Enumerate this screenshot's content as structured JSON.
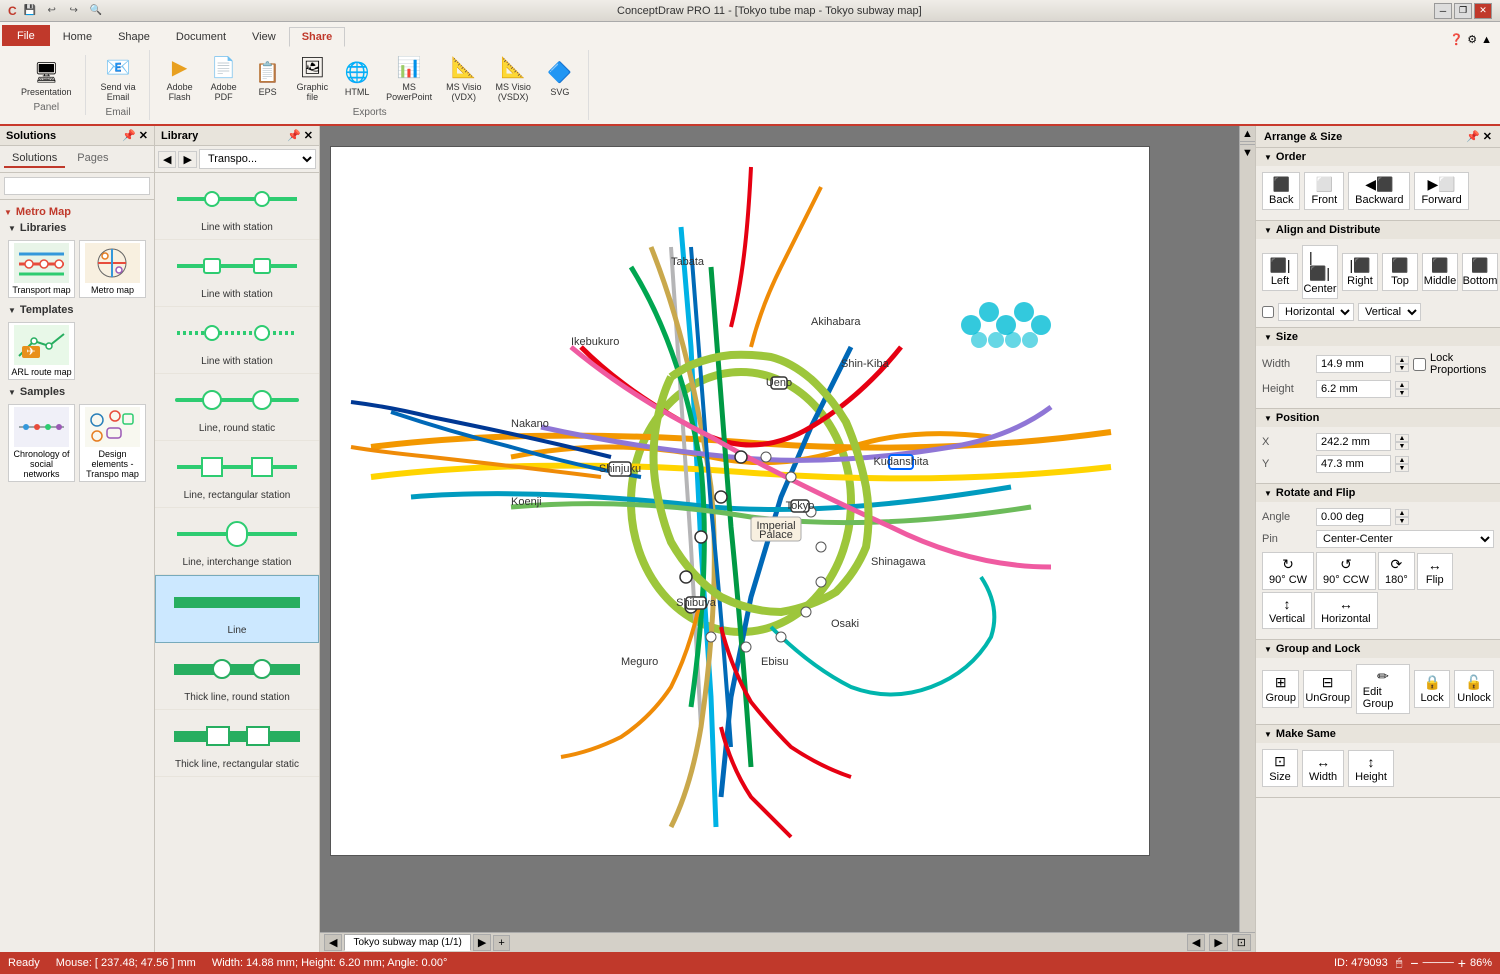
{
  "titlebar": {
    "title": "ConceptDraw PRO 11 - [Tokyo tube map - Tokyo subway map]",
    "controls": [
      "minimize",
      "restore",
      "close"
    ]
  },
  "ribbon": {
    "tabs": [
      "File",
      "Home",
      "Shape",
      "Document",
      "View",
      "Share"
    ],
    "active_tab": "Share",
    "file_tab": "File",
    "share_group": {
      "items": [
        {
          "label": "Presentation",
          "icon": "🖥",
          "group": "Panel"
        },
        {
          "label": "Send via Email",
          "icon": "📧",
          "group": "Email"
        },
        {
          "label": "Adobe Flash",
          "icon": "▶",
          "group": "Exports"
        },
        {
          "label": "Adobe PDF",
          "icon": "📄",
          "group": "Exports"
        },
        {
          "label": "EPS",
          "icon": "📋",
          "group": "Exports"
        },
        {
          "label": "Graphic file",
          "icon": "🖼",
          "group": "Exports"
        },
        {
          "label": "HTML",
          "icon": "🌐",
          "group": "Exports"
        },
        {
          "label": "MS PowerPoint",
          "icon": "📊",
          "group": "Exports"
        },
        {
          "label": "MS Visio (VDX)",
          "icon": "📐",
          "group": "Exports"
        },
        {
          "label": "MS Visio (VSDX)",
          "icon": "📐",
          "group": "Exports"
        },
        {
          "label": "SVG",
          "icon": "🔷",
          "group": "Exports"
        }
      ]
    }
  },
  "solutions": {
    "panel_title": "Solutions",
    "tabs": [
      "Solutions",
      "Pages"
    ],
    "search_placeholder": "",
    "sections": [
      {
        "name": "Metro Map",
        "subsections": [
          {
            "name": "Libraries",
            "items": [
              {
                "label": "Transport map",
                "type": "thumbnail"
              },
              {
                "label": "Metro map",
                "type": "thumbnail"
              },
              {
                "label": "ARL route map",
                "type": "thumbnail"
              },
              {
                "label": "Chronology of social networks",
                "type": "thumbnail"
              },
              {
                "label": "Design elements - Transport map",
                "type": "thumbnail"
              }
            ]
          },
          {
            "name": "Templates",
            "items": []
          },
          {
            "name": "Samples",
            "items": []
          }
        ]
      }
    ]
  },
  "library": {
    "panel_title": "Library",
    "nav_dropdown": "Transpo...",
    "items": [
      {
        "label": "Line with station",
        "type": "line_station"
      },
      {
        "label": "Line with station",
        "type": "line_station_2"
      },
      {
        "label": "Line with station",
        "type": "line_station_3"
      },
      {
        "label": "Line, round static",
        "type": "line_round"
      },
      {
        "label": "Line, rectangular station",
        "type": "line_rect"
      },
      {
        "label": "Line, interchange station",
        "type": "line_interchange"
      },
      {
        "label": "Line",
        "type": "line_plain",
        "selected": true
      },
      {
        "label": "Thick line, round station",
        "type": "thick_round"
      },
      {
        "label": "Thick line, rectangular static",
        "type": "thick_rect"
      }
    ]
  },
  "canvas": {
    "page_tab": "Tokyo subway map (1/1)",
    "background": "white"
  },
  "arrange": {
    "panel_title": "Arrange & Size",
    "sections": {
      "order": {
        "title": "Order",
        "buttons": [
          "Back",
          "Front",
          "Backward",
          "Forward"
        ]
      },
      "align": {
        "title": "Align and Distribute",
        "buttons": [
          "Left",
          "Center",
          "Right",
          "Top",
          "Middle",
          "Bottom"
        ],
        "dropdowns": [
          "Horizontal",
          "Vertical"
        ]
      },
      "size": {
        "title": "Size",
        "width_label": "Width",
        "width_value": "14.9 mm",
        "height_label": "Height",
        "height_value": "6.2 mm",
        "lock_label": "Lock Proportions"
      },
      "position": {
        "title": "Position",
        "x_label": "X",
        "x_value": "242.2 mm",
        "y_label": "Y",
        "y_value": "47.3 mm"
      },
      "rotate": {
        "title": "Rotate and Flip",
        "angle_label": "Angle",
        "angle_value": "0.00 deg",
        "pin_label": "Pin",
        "pin_value": "Center-Center",
        "buttons": [
          "90° CW",
          "90° CCW",
          "180°",
          "Flip",
          "Vertical",
          "Horizontal"
        ]
      },
      "group_lock": {
        "title": "Group and Lock",
        "buttons": [
          "Group",
          "UnGroup",
          "Edit Group",
          "Lock",
          "Unlock"
        ]
      },
      "make_same": {
        "title": "Make Same",
        "buttons": [
          "Size",
          "Width",
          "Height"
        ]
      }
    }
  },
  "statusbar": {
    "ready": "Ready",
    "mouse_pos": "Mouse: [ 237.48; 47.56 ] mm",
    "dimensions": "Width: 14.88 mm; Height: 6.20 mm; Angle: 0.00°",
    "id": "ID: 479093",
    "zoom": "86%"
  }
}
